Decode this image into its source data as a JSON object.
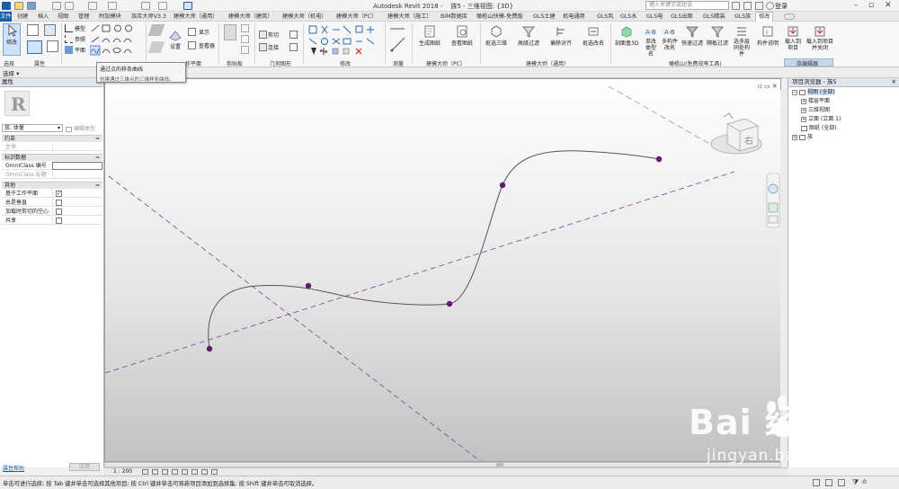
{
  "titlebar": {
    "app_title": "Autodesk Revit 2018 -",
    "doc_title": "族5 - 三维视图: {3D}",
    "search_placeholder": "键入关键字或短语",
    "login": "登录"
  },
  "tabs": [
    "文件",
    "创建",
    "插入",
    "视图",
    "管理",
    "附加模块",
    "族库大师V3.3",
    "建模大师（通用）",
    "建模大师（建筑）",
    "建模大师（机电）",
    "建模大师（PC）",
    "建模大师（施工）",
    "BIM数据库",
    "橄榄山快模-免费版",
    "GLS土建",
    "机电通用",
    "GLS风",
    "GLS水",
    "GLS电",
    "GLS出图",
    "GLS精装",
    "GLS族",
    "修改"
  ],
  "active_tab": "修改",
  "ribbon": {
    "modify_btn": "修改",
    "select_label": "选择",
    "props_label": "属性",
    "draw_items": [
      "模型",
      "参照",
      "平面"
    ],
    "workplane_group": "作平面",
    "set_btn": "设置",
    "show_btn": "显示",
    "viewer_btn": "查看器",
    "clipboard_group": "剪贴板",
    "cut_btn": "剪切",
    "join_btn": "连接",
    "geometry_group": "几何图形",
    "modify_group": "修改",
    "measure_group": "测量",
    "create_group": "创建",
    "pc_group": "建模大师（PC）",
    "pc_btns": [
      "生成图纸",
      "查看图纸"
    ],
    "general_btns": [
      "抠选三维",
      "高级过滤",
      "偏移对齐",
      "抠选改名"
    ],
    "general_group": "建模大师（通用）",
    "gls_btns": [
      "剖面盒3D",
      "单改类型名",
      "多构件改名",
      "快速过滤",
      "隔板过滤",
      "选多层同处构件",
      "构件说明",
      "载入到项目",
      "载入到项目并关闭"
    ],
    "gls_group": "橄榄山(免费效率工具)",
    "family_group": "族编辑器"
  },
  "optionbar": {
    "select": "选择 ▾"
  },
  "tooltip": {
    "title": "通过点的样条曲线",
    "desc": "创建通过三维点的三维样条曲线。"
  },
  "properties": {
    "header": "属性",
    "type_value": "族: 体量",
    "edit_type": "编辑类型",
    "sections": {
      "constraints": "约束",
      "identity": "标识数据",
      "other": "其他"
    },
    "rows": {
      "host": "主体",
      "omniclass_num": "OmniClass 编号",
      "omniclass_title": "OmniClass 标题",
      "work_plane_based": "基于工作平面",
      "always_vertical": "总是垂直",
      "cut_with_voids": "加载时剪切的空心",
      "shared": "共享"
    },
    "help": "属性帮助",
    "apply": "应用"
  },
  "browser": {
    "header": "项目浏览器 - 族5",
    "items": [
      "视图 (全部)",
      "楼层平面",
      "三维视图",
      "立面 (立面 1)",
      "图纸 (全部)",
      "族"
    ]
  },
  "viewbar": {
    "scale": "1 : 200"
  },
  "status": {
    "text": "单击可进行选择; 按 Tab 键并单击可选择其他项目; 按 Ctrl 键并单击可将新项目添加到选择集; 按 Shift 键并单击可取消选择。"
  },
  "watermark": {
    "brand": "Bai  经验",
    "url": "jingyan.baidu.com"
  },
  "viewcube": {
    "face": "右"
  },
  "colors": {
    "accent": "#1d5ea8",
    "curve_point": "#5c1d6b",
    "ref_line": "#7a3ea0"
  }
}
